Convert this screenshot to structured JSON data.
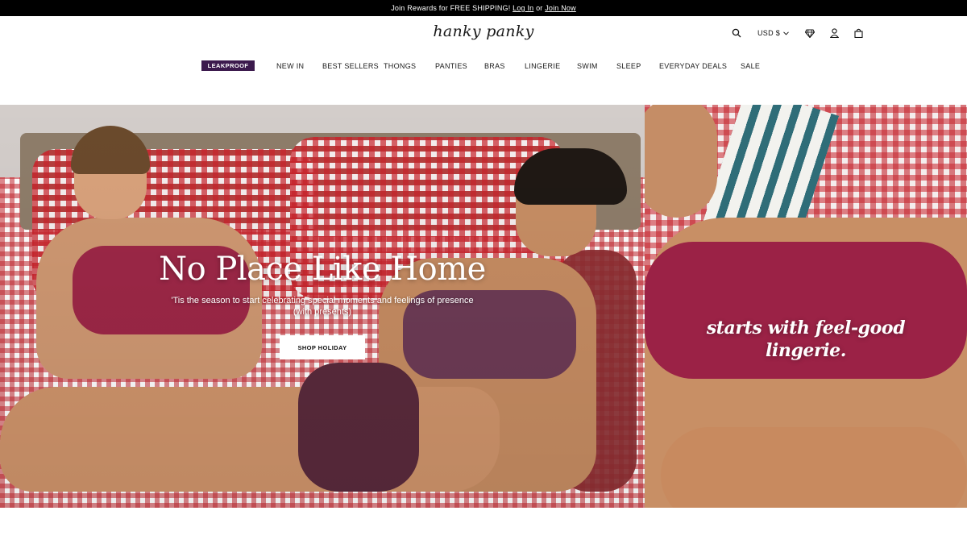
{
  "announcement": {
    "prefix": "Join Rewards for FREE SHIPPING! ",
    "login": "Log In",
    "middle": " or ",
    "join": "Join Now"
  },
  "header": {
    "logo": "hanky panky",
    "currency": "USD $",
    "icons": [
      "search-icon",
      "chevron-down-icon",
      "diamond-icon",
      "user-icon",
      "bag-icon"
    ]
  },
  "nav": {
    "badge": "LEAKPROOF",
    "items": [
      "NEW IN",
      "BEST SELLERS",
      "THONGS",
      "PANTIES",
      "BRAS",
      "LINGERIE",
      "SWIM",
      "SLEEP",
      "EVERYDAY DEALS",
      "SALE"
    ]
  },
  "hero": {
    "title": "No Place Like Home",
    "subtitle_line1": "'Tis the season to start celebrating special moments and feelings of presence",
    "subtitle_line2": "(with presents)",
    "button": "SHOP HOLIDAY",
    "side_line1": "starts with feel-good",
    "side_line2": "lingerie."
  },
  "colors": {
    "announcement_bg": "#000000",
    "badge_bg": "#3c1a4d",
    "lace": "#9b2246"
  }
}
